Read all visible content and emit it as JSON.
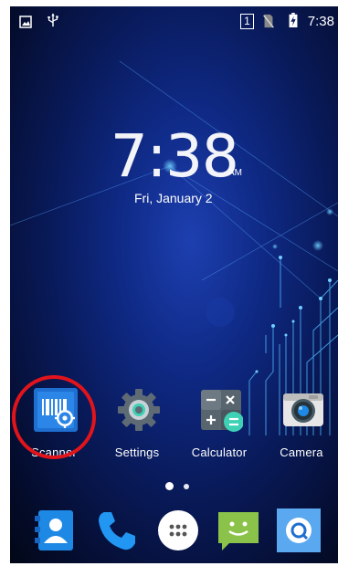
{
  "status_bar": {
    "time": "7:38",
    "sim_slot": "1",
    "icons": [
      "image-notification-icon",
      "usb-icon",
      "no-sim-icon",
      "battery-charging-icon"
    ]
  },
  "clock_widget": {
    "time": "7:38",
    "ampm": "AM",
    "date": "Fri, January 2"
  },
  "apps": [
    {
      "label": "Scanner",
      "icon": "scanner-icon"
    },
    {
      "label": "Settings",
      "icon": "settings-icon"
    },
    {
      "label": "Calculator",
      "icon": "calculator-icon"
    },
    {
      "label": "Camera",
      "icon": "camera-icon"
    }
  ],
  "page_indicator": {
    "pages": 2,
    "current": 1
  },
  "dock": [
    {
      "icon": "contacts-icon"
    },
    {
      "icon": "phone-icon"
    },
    {
      "icon": "app-drawer-icon"
    },
    {
      "icon": "messaging-icon"
    },
    {
      "icon": "browser-icon"
    }
  ],
  "colors": {
    "highlight": "#e2141b",
    "wallpaper_deep": "#040c2c",
    "wallpaper_glow": "#1d3fb0",
    "circuit": "#4fb8ff"
  }
}
